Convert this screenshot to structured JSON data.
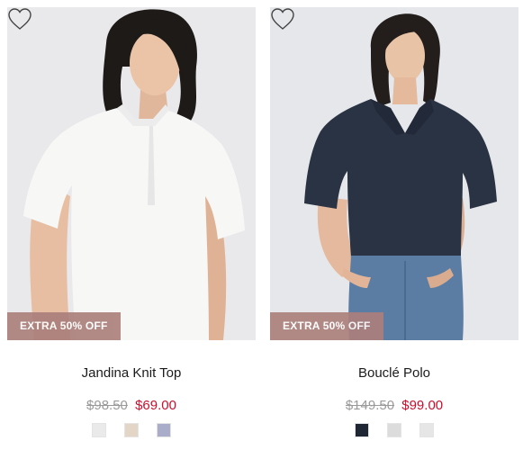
{
  "products": [
    {
      "name": "Jandina Knit Top",
      "badge": "EXTRA 50% OFF",
      "original_price": "$98.50",
      "sale_price": "$69.00",
      "image_icon": "white-knit-top-photo",
      "swatches": [
        "#eaeaea",
        "#e3d6c6",
        "#a9adc9"
      ]
    },
    {
      "name": "Bouclé Polo",
      "badge": "EXTRA 50% OFF",
      "original_price": "$149.50",
      "sale_price": "$99.00",
      "image_icon": "navy-polo-photo",
      "swatches": [
        "#1f2735",
        "#dcdcdc",
        "#e6e6e6"
      ]
    }
  ],
  "colors": {
    "badge_bg": "#ac807c",
    "sale_price": "#c8102e",
    "original_price": "#9a9a9a"
  }
}
